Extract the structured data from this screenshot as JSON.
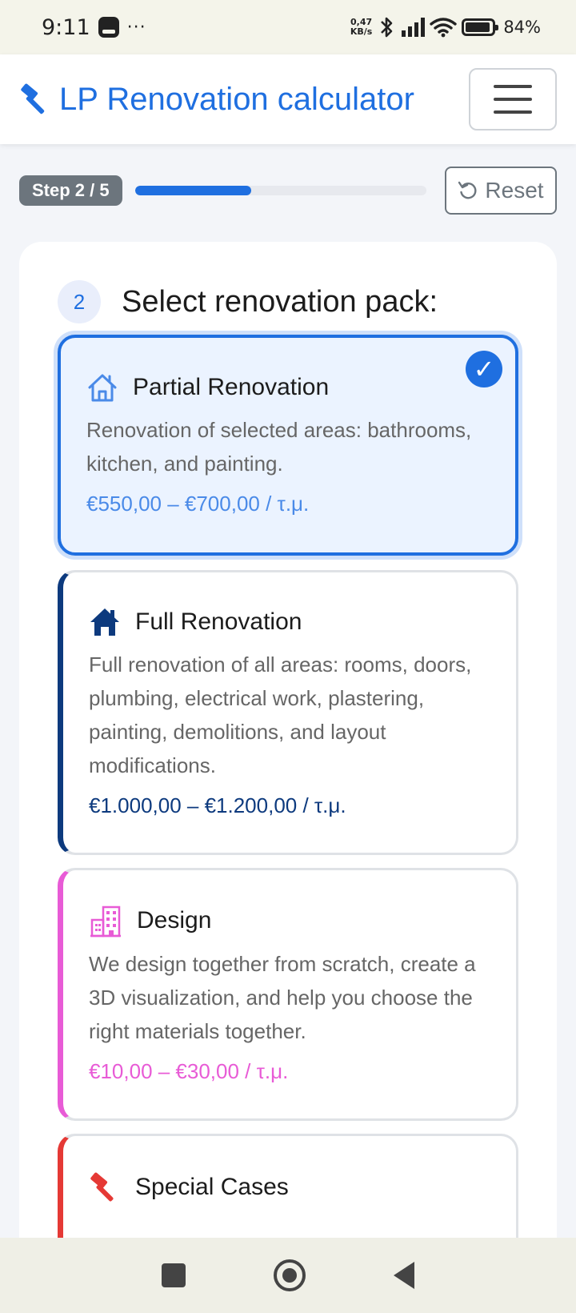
{
  "status_bar": {
    "time": "9:11",
    "dots": "···",
    "net_speed_value": "0,47",
    "net_speed_unit": "KB/s",
    "battery": "84%"
  },
  "navbar": {
    "brand_icon": "hammer-icon",
    "title": "LP Renovation calculator",
    "menu_icon": "hamburger-menu-icon"
  },
  "progress": {
    "step_label": "Step 2 / 5",
    "fraction": 0.4,
    "reset_label": "Reset",
    "reset_icon": "rotate-ccw-icon"
  },
  "section": {
    "number": "2",
    "title": "Select renovation pack:"
  },
  "options": [
    {
      "icon": "house-outline-icon",
      "title": "Partial Renovation",
      "description": "Renovation of selected areas: bathrooms, kitchen, and painting.",
      "price": "€550,00 – €700,00 / τ.μ.",
      "color": "#4a8ae8",
      "selected": true
    },
    {
      "icon": "house-filled-icon",
      "title": "Full Renovation",
      "description": "Full renovation of all areas: rooms, doors, plumbing, electrical work, plastering, painting, demolitions, and layout modifications.",
      "price": "€1.000,00 – €1.200,00 / τ.μ.",
      "color": "#0d3a7e",
      "selected": false
    },
    {
      "icon": "buildings-icon",
      "title": "Design",
      "description": "We design together from scratch, create a 3D visualization, and help you choose the right materials together.",
      "price": "€10,00 – €30,00 / τ.μ.",
      "color": "#e85bd6",
      "selected": false
    },
    {
      "icon": "hammer-icon",
      "title": "Special Cases",
      "color": "#e53935",
      "selected": false
    }
  ]
}
